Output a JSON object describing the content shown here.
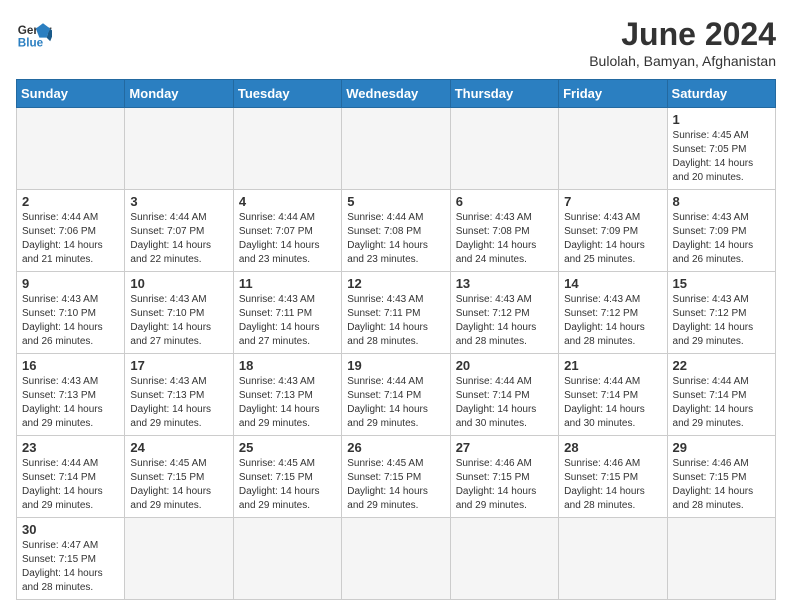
{
  "logo": {
    "line1": "General",
    "line2": "Blue"
  },
  "title": "June 2024",
  "subtitle": "Bulolah, Bamyan, Afghanistan",
  "weekdays": [
    "Sunday",
    "Monday",
    "Tuesday",
    "Wednesday",
    "Thursday",
    "Friday",
    "Saturday"
  ],
  "days": [
    {
      "num": "",
      "info": ""
    },
    {
      "num": "",
      "info": ""
    },
    {
      "num": "",
      "info": ""
    },
    {
      "num": "",
      "info": ""
    },
    {
      "num": "",
      "info": ""
    },
    {
      "num": "",
      "info": ""
    },
    {
      "num": "1",
      "info": "Sunrise: 4:45 AM\nSunset: 7:05 PM\nDaylight: 14 hours and 20 minutes."
    },
    {
      "num": "2",
      "info": "Sunrise: 4:44 AM\nSunset: 7:06 PM\nDaylight: 14 hours and 21 minutes."
    },
    {
      "num": "3",
      "info": "Sunrise: 4:44 AM\nSunset: 7:07 PM\nDaylight: 14 hours and 22 minutes."
    },
    {
      "num": "4",
      "info": "Sunrise: 4:44 AM\nSunset: 7:07 PM\nDaylight: 14 hours and 23 minutes."
    },
    {
      "num": "5",
      "info": "Sunrise: 4:44 AM\nSunset: 7:08 PM\nDaylight: 14 hours and 23 minutes."
    },
    {
      "num": "6",
      "info": "Sunrise: 4:43 AM\nSunset: 7:08 PM\nDaylight: 14 hours and 24 minutes."
    },
    {
      "num": "7",
      "info": "Sunrise: 4:43 AM\nSunset: 7:09 PM\nDaylight: 14 hours and 25 minutes."
    },
    {
      "num": "8",
      "info": "Sunrise: 4:43 AM\nSunset: 7:09 PM\nDaylight: 14 hours and 26 minutes."
    },
    {
      "num": "9",
      "info": "Sunrise: 4:43 AM\nSunset: 7:10 PM\nDaylight: 14 hours and 26 minutes."
    },
    {
      "num": "10",
      "info": "Sunrise: 4:43 AM\nSunset: 7:10 PM\nDaylight: 14 hours and 27 minutes."
    },
    {
      "num": "11",
      "info": "Sunrise: 4:43 AM\nSunset: 7:11 PM\nDaylight: 14 hours and 27 minutes."
    },
    {
      "num": "12",
      "info": "Sunrise: 4:43 AM\nSunset: 7:11 PM\nDaylight: 14 hours and 28 minutes."
    },
    {
      "num": "13",
      "info": "Sunrise: 4:43 AM\nSunset: 7:12 PM\nDaylight: 14 hours and 28 minutes."
    },
    {
      "num": "14",
      "info": "Sunrise: 4:43 AM\nSunset: 7:12 PM\nDaylight: 14 hours and 28 minutes."
    },
    {
      "num": "15",
      "info": "Sunrise: 4:43 AM\nSunset: 7:12 PM\nDaylight: 14 hours and 29 minutes."
    },
    {
      "num": "16",
      "info": "Sunrise: 4:43 AM\nSunset: 7:13 PM\nDaylight: 14 hours and 29 minutes."
    },
    {
      "num": "17",
      "info": "Sunrise: 4:43 AM\nSunset: 7:13 PM\nDaylight: 14 hours and 29 minutes."
    },
    {
      "num": "18",
      "info": "Sunrise: 4:43 AM\nSunset: 7:13 PM\nDaylight: 14 hours and 29 minutes."
    },
    {
      "num": "19",
      "info": "Sunrise: 4:44 AM\nSunset: 7:14 PM\nDaylight: 14 hours and 29 minutes."
    },
    {
      "num": "20",
      "info": "Sunrise: 4:44 AM\nSunset: 7:14 PM\nDaylight: 14 hours and 30 minutes."
    },
    {
      "num": "21",
      "info": "Sunrise: 4:44 AM\nSunset: 7:14 PM\nDaylight: 14 hours and 30 minutes."
    },
    {
      "num": "22",
      "info": "Sunrise: 4:44 AM\nSunset: 7:14 PM\nDaylight: 14 hours and 29 minutes."
    },
    {
      "num": "23",
      "info": "Sunrise: 4:44 AM\nSunset: 7:14 PM\nDaylight: 14 hours and 29 minutes."
    },
    {
      "num": "24",
      "info": "Sunrise: 4:45 AM\nSunset: 7:15 PM\nDaylight: 14 hours and 29 minutes."
    },
    {
      "num": "25",
      "info": "Sunrise: 4:45 AM\nSunset: 7:15 PM\nDaylight: 14 hours and 29 minutes."
    },
    {
      "num": "26",
      "info": "Sunrise: 4:45 AM\nSunset: 7:15 PM\nDaylight: 14 hours and 29 minutes."
    },
    {
      "num": "27",
      "info": "Sunrise: 4:46 AM\nSunset: 7:15 PM\nDaylight: 14 hours and 29 minutes."
    },
    {
      "num": "28",
      "info": "Sunrise: 4:46 AM\nSunset: 7:15 PM\nDaylight: 14 hours and 28 minutes."
    },
    {
      "num": "29",
      "info": "Sunrise: 4:46 AM\nSunset: 7:15 PM\nDaylight: 14 hours and 28 minutes."
    },
    {
      "num": "30",
      "info": "Sunrise: 4:47 AM\nSunset: 7:15 PM\nDaylight: 14 hours and 28 minutes."
    }
  ]
}
